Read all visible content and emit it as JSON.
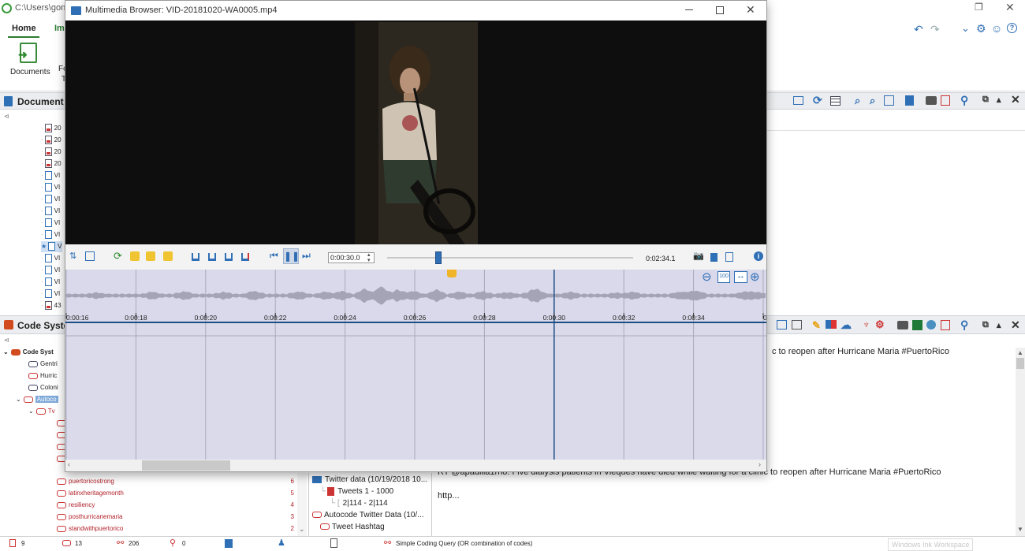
{
  "back_window": {
    "title": "C:\\Users\\gonz",
    "ribbon_tabs": [
      "Home",
      "Im"
    ],
    "ribbon_items": [
      {
        "label": "Documents"
      },
      {
        "label": "Fo"
      }
    ],
    "ribbon_extra": "T",
    "document_browser_title": "Document",
    "code_system_title": "Code Syste",
    "documents": [
      {
        "label": "20",
        "type": "image"
      },
      {
        "label": "20",
        "type": "image"
      },
      {
        "label": "20",
        "type": "image"
      },
      {
        "label": "20",
        "type": "image"
      },
      {
        "label": "VI",
        "type": "video"
      },
      {
        "label": "VI",
        "type": "video"
      },
      {
        "label": "VI",
        "type": "video"
      },
      {
        "label": "VI",
        "type": "video"
      },
      {
        "label": "VI",
        "type": "video"
      },
      {
        "label": "VI",
        "type": "video"
      },
      {
        "label": "V",
        "type": "video",
        "selected": true
      },
      {
        "label": "VI",
        "type": "video"
      },
      {
        "label": "VI",
        "type": "video"
      },
      {
        "label": "VI",
        "type": "video"
      },
      {
        "label": "VI",
        "type": "video"
      },
      {
        "label": "43",
        "type": "image"
      }
    ],
    "codes_top": [
      {
        "label": "Code Syst"
      },
      {
        "label": "Gentri"
      },
      {
        "label": "Hurric"
      },
      {
        "label": "Coloni"
      },
      {
        "label": "Autoco"
      },
      {
        "label": "Tv"
      }
    ],
    "codes": [
      {
        "label": "puertoricostrong",
        "count": "6"
      },
      {
        "label": "latinxheritagemonth",
        "count": "5"
      },
      {
        "label": "resiliency",
        "count": "4"
      },
      {
        "label": "posthurricanemaria",
        "count": "3"
      },
      {
        "label": "standwithpuertorico",
        "count": "2"
      }
    ],
    "retrieved_segments": [
      {
        "label": "Twitter data (10/19/2018 10..."
      },
      {
        "label": "Tweets 1 - 1000"
      },
      {
        "label": "2|114 - 2|114"
      },
      {
        "label": "Autocode Twitter Data (10/..."
      },
      {
        "label": "Tweet Hashtag"
      }
    ],
    "text_lines": {
      "line1": "c to reopen after Hurricane Maria #PuertoRico",
      "line2": "RT @apadilla1rno: Five dialysis patients in Vieques have died while waiting for a clinic to reopen after Hurricane Maria #PuertoRico",
      "line3": "http..."
    },
    "status": {
      "docs": "9",
      "codes": "13",
      "segments": "206",
      "memos": "0",
      "query": "Simple Coding Query (OR combination of codes)",
      "ink": "Windows Ink Workspace"
    }
  },
  "media_window": {
    "title": "Multimedia Browser:  VID-20181020-WA0005.mp4",
    "skip_interval": "0:00:30.0",
    "total_time": "0:02:34.1",
    "playback_position": 0.207,
    "zoom_label": "100",
    "timeline_ticks": [
      "0:00:16",
      "0:00:18",
      "0:00:20",
      "0:00:22",
      "0:00:24",
      "0:00:26",
      "0:00:28",
      "0:00:30",
      "0:00:32",
      "0:00:34",
      "0:0"
    ]
  },
  "colors": {
    "accent_blue": "#2f6fb5",
    "code_red": "#b2222a",
    "waveform": "#a4a4b6",
    "video_bg": "#0e0e0e"
  }
}
